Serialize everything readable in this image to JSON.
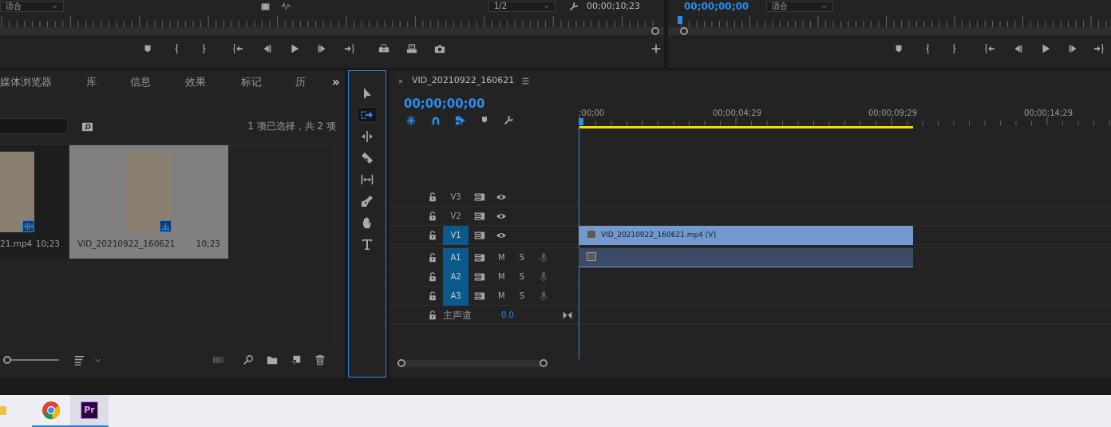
{
  "source_monitor": {
    "fit_dropdown": "适合",
    "resolution_dropdown": "1/2",
    "timecode": "00;00;10;23"
  },
  "program_monitor": {
    "timecode": "00;00;00;00",
    "fit_dropdown": "适合"
  },
  "project_panel": {
    "tabs": [
      {
        "label": "媒体浏览器",
        "selected": false
      },
      {
        "label": "库",
        "selected": false
      },
      {
        "label": "信息",
        "selected": false
      },
      {
        "label": "效果",
        "selected": false
      },
      {
        "label": "标记",
        "selected": false
      },
      {
        "label": "历",
        "selected": false
      }
    ],
    "overflow": "»",
    "selection_info": "1 项已选择，共 2 项",
    "zoom_slider": {
      "level": 0
    },
    "clips": [
      {
        "name": "21.mp4",
        "duration": "10;23",
        "selected": false
      },
      {
        "name": "VID_20210922_160621",
        "duration": "10;23",
        "selected": true
      }
    ]
  },
  "tools": [
    {
      "kind": "selection",
      "selected": false
    },
    {
      "kind": "track-select",
      "selected": true
    },
    {
      "kind": "ripple",
      "selected": false
    },
    {
      "kind": "razor",
      "selected": false
    },
    {
      "kind": "slip",
      "selected": false
    },
    {
      "kind": "pen",
      "selected": false
    },
    {
      "kind": "hand",
      "selected": false
    },
    {
      "kind": "type",
      "selected": false
    }
  ],
  "timeline": {
    "sequence_name": "VID_20210922_160621",
    "timecode": "00;00;00;00",
    "ruler_labels": [
      ";00;00",
      "00;00;04;29",
      "00;00;09;29",
      "00;00;14;29"
    ],
    "tracks": [
      {
        "kind": "video",
        "name": "V3",
        "targeted": false
      },
      {
        "kind": "video",
        "name": "V2",
        "targeted": false
      },
      {
        "kind": "video",
        "name": "V1",
        "targeted": true,
        "clip": {
          "label": "VID_20210922_160621.mp4 [V]",
          "fx": true
        }
      },
      {
        "kind": "audio",
        "name": "A1",
        "targeted": true,
        "mute": "M",
        "solo": "S",
        "clip": {
          "fx": true
        }
      },
      {
        "kind": "audio",
        "name": "A2",
        "targeted": true,
        "mute": "M",
        "solo": "S"
      },
      {
        "kind": "audio",
        "name": "A3",
        "targeted": true,
        "mute": "M",
        "solo": "S"
      }
    ],
    "master": {
      "label": "主声道",
      "value": "0.0"
    }
  },
  "taskbar": [
    {
      "kind": "folder",
      "running": false,
      "selected": false
    },
    {
      "kind": "chrome",
      "running": true,
      "selected": false
    },
    {
      "kind": "premiere",
      "label": "Pr",
      "running": true,
      "selected": true
    }
  ]
}
